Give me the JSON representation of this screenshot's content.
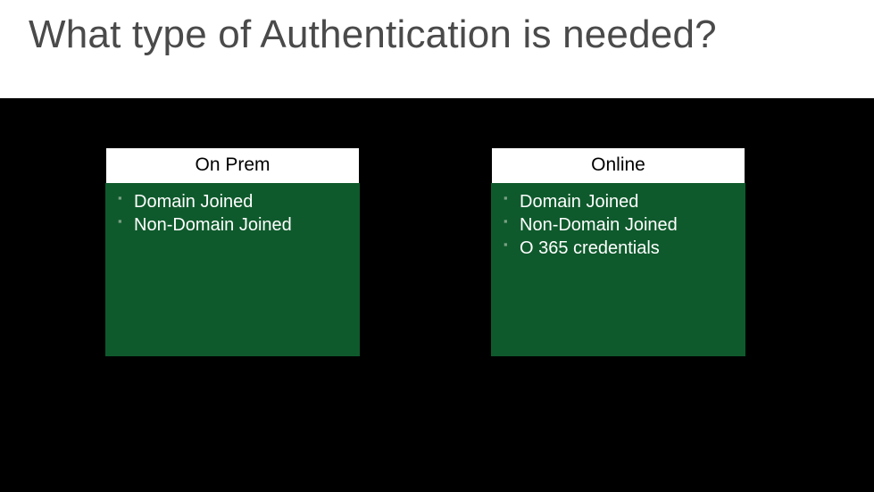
{
  "title": "What type of Authentication is needed?",
  "cards": {
    "left": {
      "header": "On Prem",
      "bullets": [
        "Domain Joined",
        "Non-Domain Joined"
      ]
    },
    "right": {
      "header": "Online",
      "bullets": [
        "Domain Joined",
        "Non-Domain Joined",
        "O 365 credentials"
      ]
    }
  }
}
